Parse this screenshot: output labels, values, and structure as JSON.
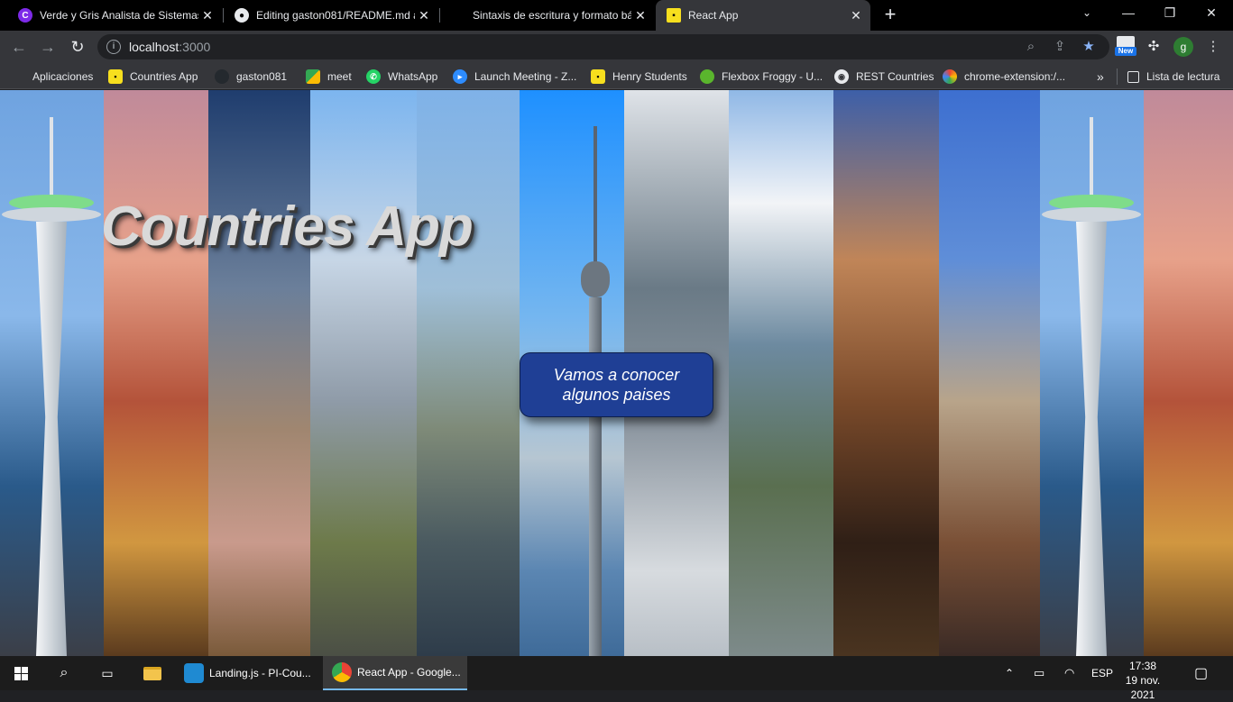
{
  "tabs": [
    {
      "title": "Verde y Gris Analista de Sistemas",
      "favicon": "canva-icon"
    },
    {
      "title": "Editing gaston081/README.md at",
      "favicon": "github-icon"
    },
    {
      "title": "Sintaxis de escritura y formato bá",
      "favicon": ""
    },
    {
      "title": "React App",
      "favicon": "app-icon"
    }
  ],
  "address": {
    "host": "localhost",
    "port": ":3000"
  },
  "bookmarks": [
    {
      "label": "Aplicaciones",
      "icon": "apps-grid-icon"
    },
    {
      "label": "Countries App",
      "icon": "app-icon"
    },
    {
      "label": "gaston081",
      "icon": "github-icon"
    },
    {
      "label": "meet",
      "icon": "meet-icon"
    },
    {
      "label": "WhatsApp",
      "icon": "whatsapp-icon"
    },
    {
      "label": "Launch Meeting - Z...",
      "icon": "zoom-icon"
    },
    {
      "label": "Henry Students",
      "icon": "app-icon"
    },
    {
      "label": "Flexbox Froggy - U...",
      "icon": "froggy-icon"
    },
    {
      "label": "REST Countries",
      "icon": "globe-icon"
    },
    {
      "label": "chrome-extension:/...",
      "icon": "extension-icon"
    }
  ],
  "reading_list": "Lista de lectura",
  "extension_badge": "New",
  "profile_initial": "g",
  "landing": {
    "title": "Countries App",
    "button": "Vamos a conocer algunos paises"
  },
  "taskbar": {
    "apps": [
      {
        "label": "Landing.js - PI-Cou..."
      },
      {
        "label": "React App - Google..."
      }
    ],
    "language": "ESP",
    "time": "17:38",
    "date": "19 nov. 2021"
  },
  "colors": {
    "button_bg": "#1f3f95",
    "title_text": "#d9d9d9",
    "accent_yellow": "#f7df1e"
  }
}
